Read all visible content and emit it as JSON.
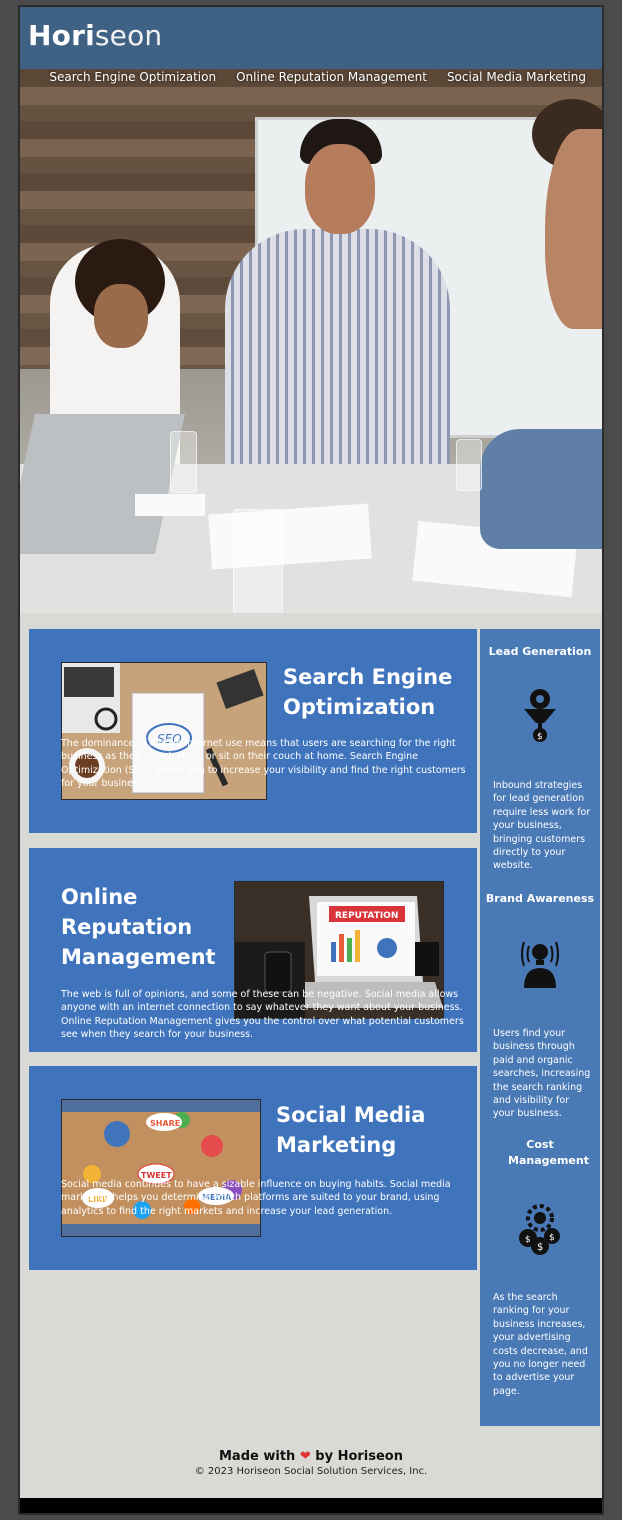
{
  "brand": {
    "logo_main": "Hori",
    "logo_accent": "seon"
  },
  "nav": {
    "items": [
      "Search Engine Optimization",
      "Online Reputation Management",
      "Social Media Marketing"
    ]
  },
  "sections": {
    "seo": {
      "title": "Search Engine Optimization",
      "body": "The dominance of mobile internet use means that users are searching for the right business as they travel, shop, or sit on their couch at home. Search Engine Optimization (SEO) allows you to increase your visibility and find the right customers for your business."
    },
    "orm": {
      "title": "Online Reputation Management",
      "body": "The web is full of opinions, and some of these can be negative. Social media allows anyone with an internet connection to say whatever they want about your business. Online Reputation Management gives you the control over what potential customers see when they search for your business."
    },
    "smm": {
      "title": "Social Media Marketing",
      "body": "Social media continues to have a sizable influence on buying habits. Social media marketing helps you determine which platforms are suited to your brand, using analytics to find the right markets and increase your lead generation."
    }
  },
  "sidebar": {
    "lead": {
      "title": "Lead Generation",
      "icon": "funnel-dollar-icon",
      "text": "Inbound strategies for lead generation require less work for your business, bringing customers directly to your website."
    },
    "brand": {
      "title": "Brand Awareness",
      "icon": "lightbulb-person-icon",
      "text": "Users find your business through paid and organic searches, increasing the search ranking and visibility for your business."
    },
    "cost": {
      "title": "Cost Management",
      "icon": "dollar-gear-icon",
      "text": "As the search ranking for your business increases, your advertising costs decrease, and you no longer need to advertise your page."
    }
  },
  "footer": {
    "made_prefix": "Made with",
    "made_suffix": "by Horiseon",
    "copyright": "© 2023 Horiseon Social Solution Services, Inc."
  },
  "images": {
    "seo_card_text": "SEO",
    "reputation_label": "REPUTATION",
    "social_labels": [
      "SHARE",
      "TWEET",
      "LIKE",
      "MEDIA"
    ]
  },
  "colors": {
    "header": "#3f6183",
    "section": "#3f74bd",
    "sidebar": "#4a7ab6",
    "page_bg": "#d9d9d6",
    "heart": "#e03535"
  }
}
